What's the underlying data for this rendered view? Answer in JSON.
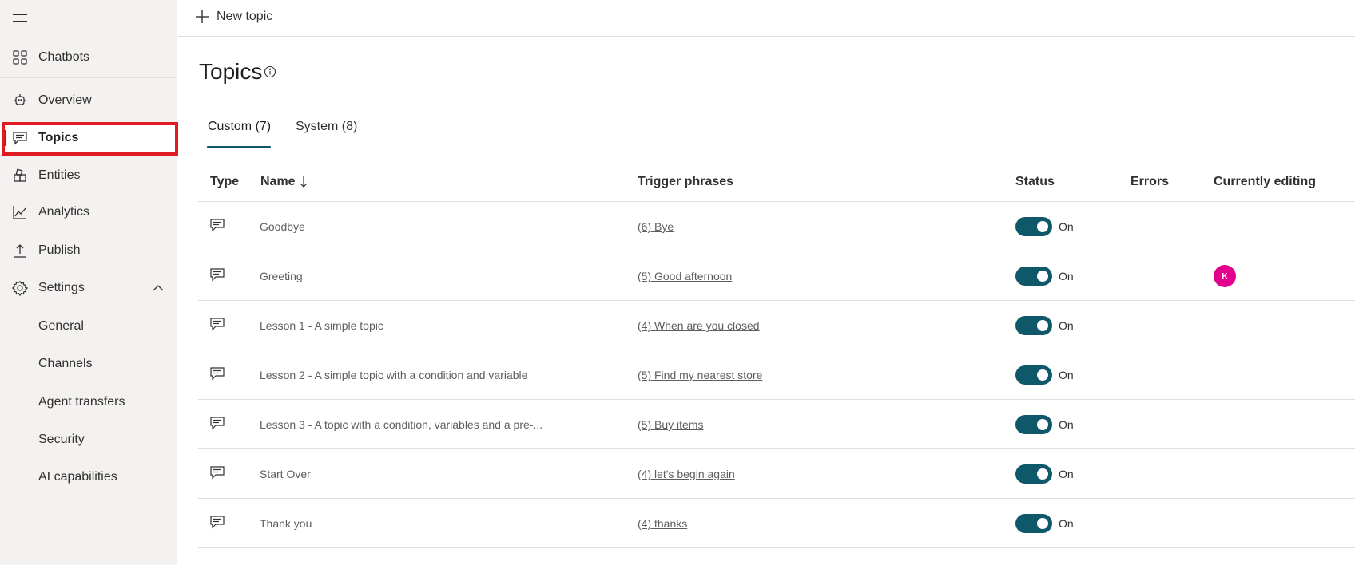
{
  "top_bar": {
    "new_topic_label": "New topic"
  },
  "sidebar": {
    "items": [
      {
        "label": "Chatbots"
      },
      {
        "label": "Overview"
      },
      {
        "label": "Topics"
      },
      {
        "label": "Entities"
      },
      {
        "label": "Analytics"
      },
      {
        "label": "Publish"
      },
      {
        "label": "Settings"
      }
    ],
    "settings_sub": [
      {
        "label": "General"
      },
      {
        "label": "Channels"
      },
      {
        "label": "Agent transfers"
      },
      {
        "label": "Security"
      },
      {
        "label": "AI capabilities"
      }
    ]
  },
  "page": {
    "title": "Topics"
  },
  "tabs": [
    {
      "label": "Custom (7)",
      "active": true
    },
    {
      "label": "System (8)",
      "active": false
    }
  ],
  "table": {
    "columns": [
      "Type",
      "Name",
      "Trigger phrases",
      "Status",
      "Errors",
      "Currently editing"
    ],
    "rows": [
      {
        "name": "Goodbye",
        "trigger": "(6) Bye",
        "status": "On",
        "editing": ""
      },
      {
        "name": "Greeting",
        "trigger": "(5) Good afternoon",
        "status": "On",
        "editing": "K"
      },
      {
        "name": "Lesson 1 - A simple topic",
        "trigger": "(4) When are you closed",
        "status": "On",
        "editing": ""
      },
      {
        "name": "Lesson 2 - A simple topic with a condition and variable",
        "trigger": "(5) Find my nearest store",
        "status": "On",
        "editing": ""
      },
      {
        "name": "Lesson 3 - A topic with a condition, variables and a pre-...",
        "trigger": "(5) Buy items",
        "status": "On",
        "editing": ""
      },
      {
        "name": "Start Over",
        "trigger": "(4) let's begin again",
        "status": "On",
        "editing": ""
      },
      {
        "name": "Thank you",
        "trigger": "(4) thanks",
        "status": "On",
        "editing": ""
      }
    ]
  },
  "colors": {
    "accent": "#0f5869",
    "highlight": "#e01b24",
    "avatar": "#e3008c"
  },
  "icons": {
    "menu": "hamburger-icon",
    "chatbots": "grid-icon",
    "overview": "bot-icon",
    "topics": "chat-icon",
    "entities": "entities-icon",
    "analytics": "chart-line-icon",
    "publish": "upload-icon",
    "settings": "gear-icon"
  }
}
